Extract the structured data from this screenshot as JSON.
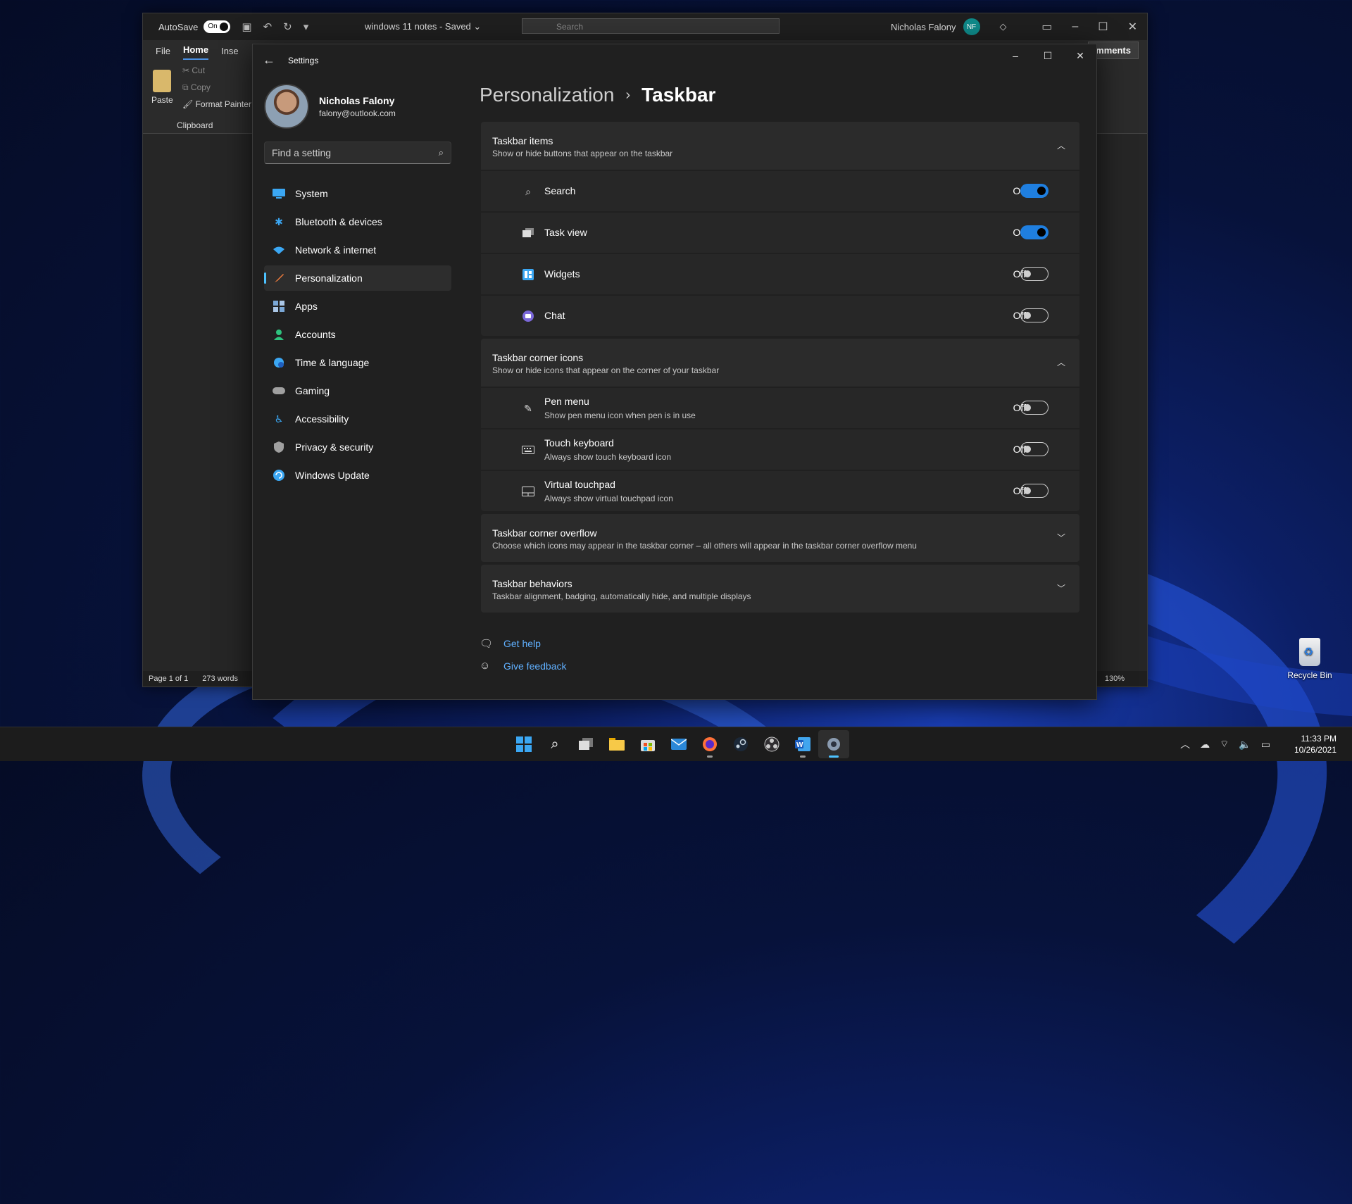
{
  "word": {
    "autosave_label": "AutoSave",
    "autosave_state": "On",
    "doc_name": "windows 11 notes  -  Saved  ⌄",
    "search_placeholder": "Search",
    "user_name": "Nicholas Falony",
    "user_initials": "NF",
    "tabs": [
      "File",
      "Home",
      "Inse"
    ],
    "comments_label": "mments",
    "ribbon": {
      "paste": "Paste",
      "cut": "Cut",
      "copy": "Copy",
      "format_painter": "Format Painter",
      "clipboard": "Clipboard"
    },
    "status": {
      "page": "Page 1 of 1",
      "words": "273 words",
      "zoom": "130%"
    }
  },
  "settings": {
    "app_title": "Settings",
    "profile": {
      "name": "Nicholas Falony",
      "email": "falony@outlook.com"
    },
    "search_placeholder": "Find a setting",
    "nav": [
      {
        "label": "System",
        "icon": "system-icon",
        "color": "#3ba7f3"
      },
      {
        "label": "Bluetooth & devices",
        "icon": "bluetooth-icon",
        "color": "#3ba7f3"
      },
      {
        "label": "Network & internet",
        "icon": "wifi-icon",
        "color": "#3ba7f3"
      },
      {
        "label": "Personalization",
        "icon": "brush-icon",
        "color": "#f07c3c",
        "active": true
      },
      {
        "label": "Apps",
        "icon": "apps-icon",
        "color": "#7aa7d6"
      },
      {
        "label": "Accounts",
        "icon": "accounts-icon",
        "color": "#2ec27e"
      },
      {
        "label": "Time & language",
        "icon": "globe-icon",
        "color": "#3ba7f3"
      },
      {
        "label": "Gaming",
        "icon": "gamepad-icon",
        "color": "#a0a0a0"
      },
      {
        "label": "Accessibility",
        "icon": "accessibility-icon",
        "color": "#3ba7f3"
      },
      {
        "label": "Privacy & security",
        "icon": "shield-icon",
        "color": "#a0a0a0"
      },
      {
        "label": "Windows Update",
        "icon": "update-icon",
        "color": "#3ba7f3"
      }
    ],
    "breadcrumb": {
      "parent": "Personalization",
      "separator": "›",
      "current": "Taskbar"
    },
    "groups": [
      {
        "title": "Taskbar items",
        "desc": "Show or hide buttons that appear on the taskbar",
        "expanded": true,
        "rows": [
          {
            "label": "Search",
            "state": "On",
            "icon": "search-icon"
          },
          {
            "label": "Task view",
            "state": "On",
            "icon": "task-view-icon"
          },
          {
            "label": "Widgets",
            "state": "Off",
            "icon": "widgets-icon"
          },
          {
            "label": "Chat",
            "state": "Off",
            "icon": "chat-icon"
          }
        ]
      },
      {
        "title": "Taskbar corner icons",
        "desc": "Show or hide icons that appear on the corner of your taskbar",
        "expanded": true,
        "rows": [
          {
            "label": "Pen menu",
            "sub": "Show pen menu icon when pen is in use",
            "state": "Off",
            "icon": "pen-icon"
          },
          {
            "label": "Touch keyboard",
            "sub": "Always show touch keyboard icon",
            "state": "Off",
            "icon": "keyboard-icon"
          },
          {
            "label": "Virtual touchpad",
            "sub": "Always show virtual touchpad icon",
            "state": "Off",
            "icon": "touchpad-icon"
          }
        ]
      },
      {
        "title": "Taskbar corner overflow",
        "desc": "Choose which icons may appear in the taskbar corner – all others will appear in the taskbar corner overflow menu",
        "expanded": false
      },
      {
        "title": "Taskbar behaviors",
        "desc": "Taskbar alignment, badging, automatically hide, and multiple displays",
        "expanded": false
      }
    ],
    "links": {
      "help": "Get help",
      "feedback": "Give feedback"
    }
  },
  "desktop": {
    "recycle_bin": "Recycle Bin"
  },
  "taskbar": {
    "time": "11:33 PM",
    "date": "10/26/2021",
    "apps": [
      "start-icon",
      "search-icon",
      "task-view-icon",
      "file-explorer-icon",
      "store-icon",
      "mail-icon",
      "firefox-icon",
      "steam-icon",
      "obs-icon",
      "word-icon",
      "settings-icon"
    ]
  }
}
